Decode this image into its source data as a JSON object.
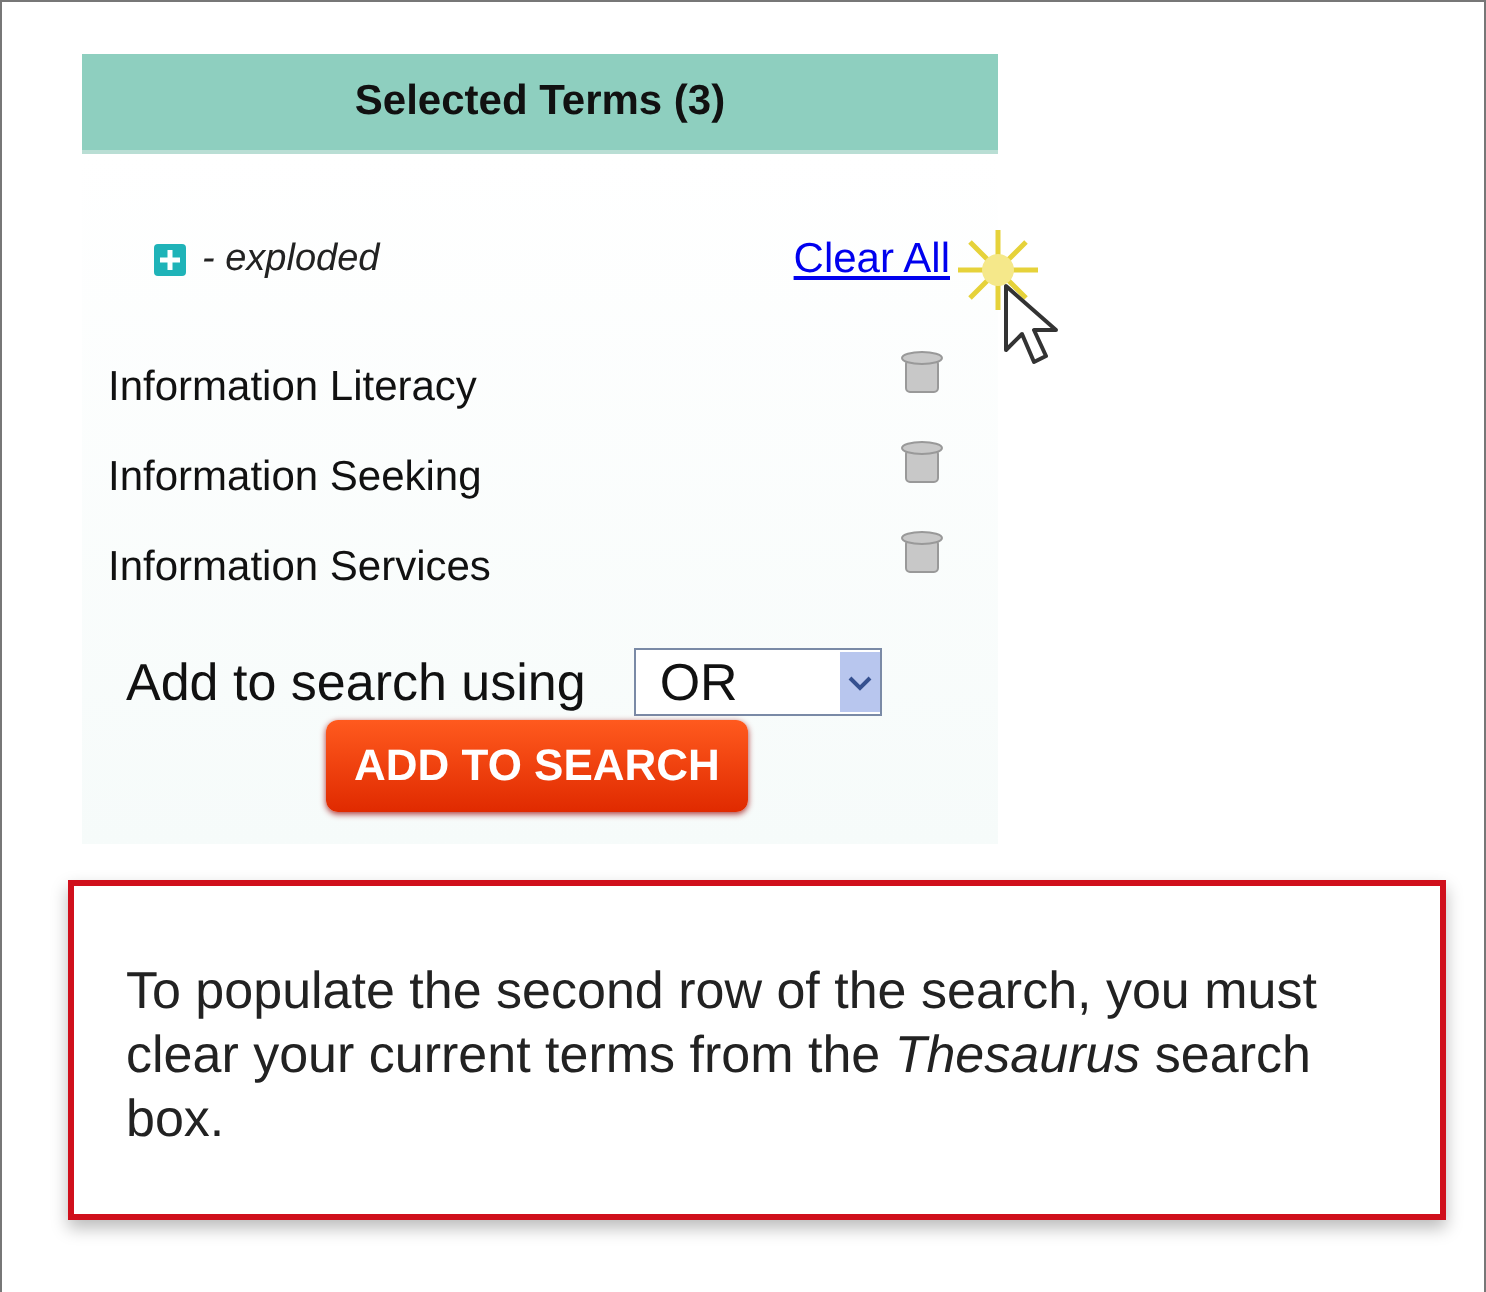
{
  "panel": {
    "title": "Selected Terms (3)",
    "legend": {
      "label": "- exploded"
    },
    "clear_all": "Clear All",
    "terms": [
      {
        "name": "Information Literacy"
      },
      {
        "name": "Information Seeking"
      },
      {
        "name": "Information Services"
      }
    ],
    "combine": {
      "label": "Add to search using",
      "value": "OR"
    },
    "add_button": "ADD TO SEARCH"
  },
  "note": "To populate the second row of the search, you must clear your current terms from the *Thesaurus* search box."
}
